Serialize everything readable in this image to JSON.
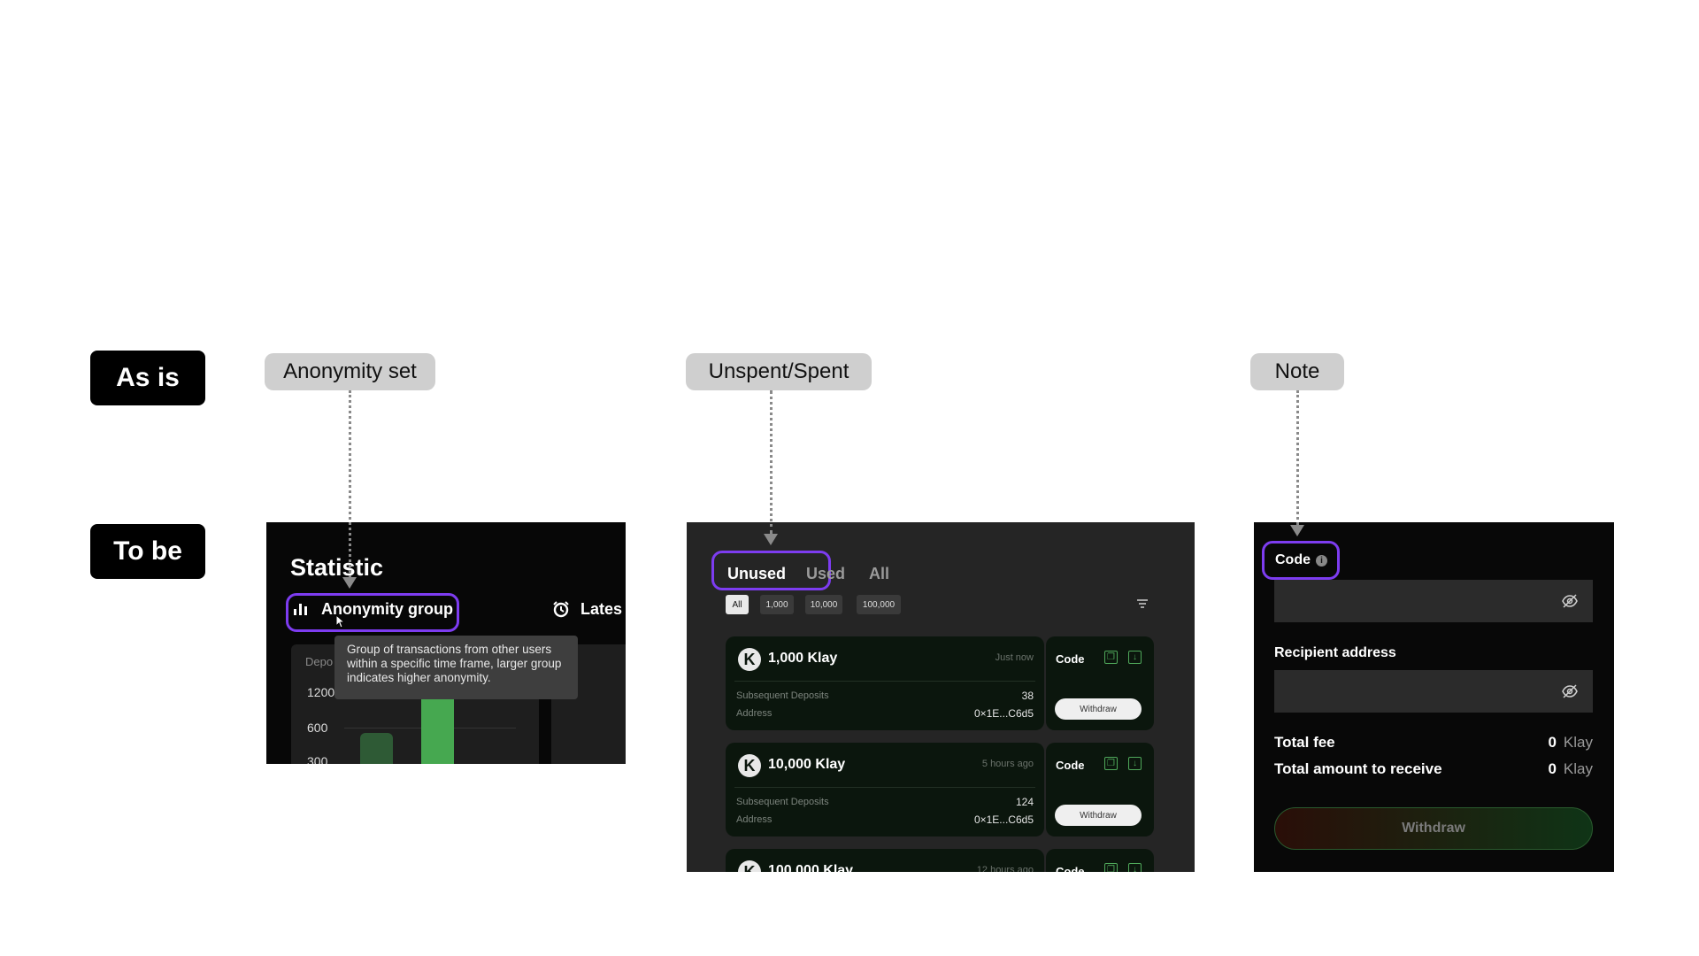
{
  "rows": {
    "as_is": "As is",
    "to_be": "To be"
  },
  "callouts": {
    "anonymity": "Anonymity set",
    "spent": "Unspent/Spent",
    "note": "Note"
  },
  "statistic": {
    "title": "Statistic",
    "tab_anonymity": "Anonymity group",
    "tab_latest": "Lates",
    "tooltip": "Group of transactions from other users within a specific time frame, larger group indicates higher anonymity.",
    "deposits_label": "Depo",
    "y_labels": [
      "1200",
      "600",
      "300"
    ],
    "bar_levels": [
      0.45,
      0.85
    ]
  },
  "deposits": {
    "tabs": [
      "Unused",
      "Used",
      "All"
    ],
    "chips": [
      "All",
      "1,000",
      "10,000",
      "100,000"
    ],
    "subsequent_label": "Subsequent Deposits",
    "address_label": "Address",
    "code_label": "Code",
    "withdraw_label": "Withdraw",
    "items": [
      {
        "amount": "1,000 Klay",
        "time": "Just now",
        "subsequent": "38",
        "address": "0×1E...C6d5"
      },
      {
        "amount": "10,000 Klay",
        "time": "5 hours ago",
        "subsequent": "124",
        "address": "0×1E...C6d5"
      },
      {
        "amount": "100,000 Klay",
        "time": "12 hours ago",
        "subsequent": "",
        "address": ""
      }
    ]
  },
  "withdraw_form": {
    "code_label": "Code",
    "recipient_label": "Recipient address",
    "total_fee_label": "Total fee",
    "total_fee_value": "0",
    "total_receive_label": "Total amount to receive",
    "total_receive_value": "0",
    "unit": "Klay",
    "button": "Withdraw"
  },
  "colors": {
    "accent": "#7d3cf0",
    "green": "#4fa85a"
  }
}
